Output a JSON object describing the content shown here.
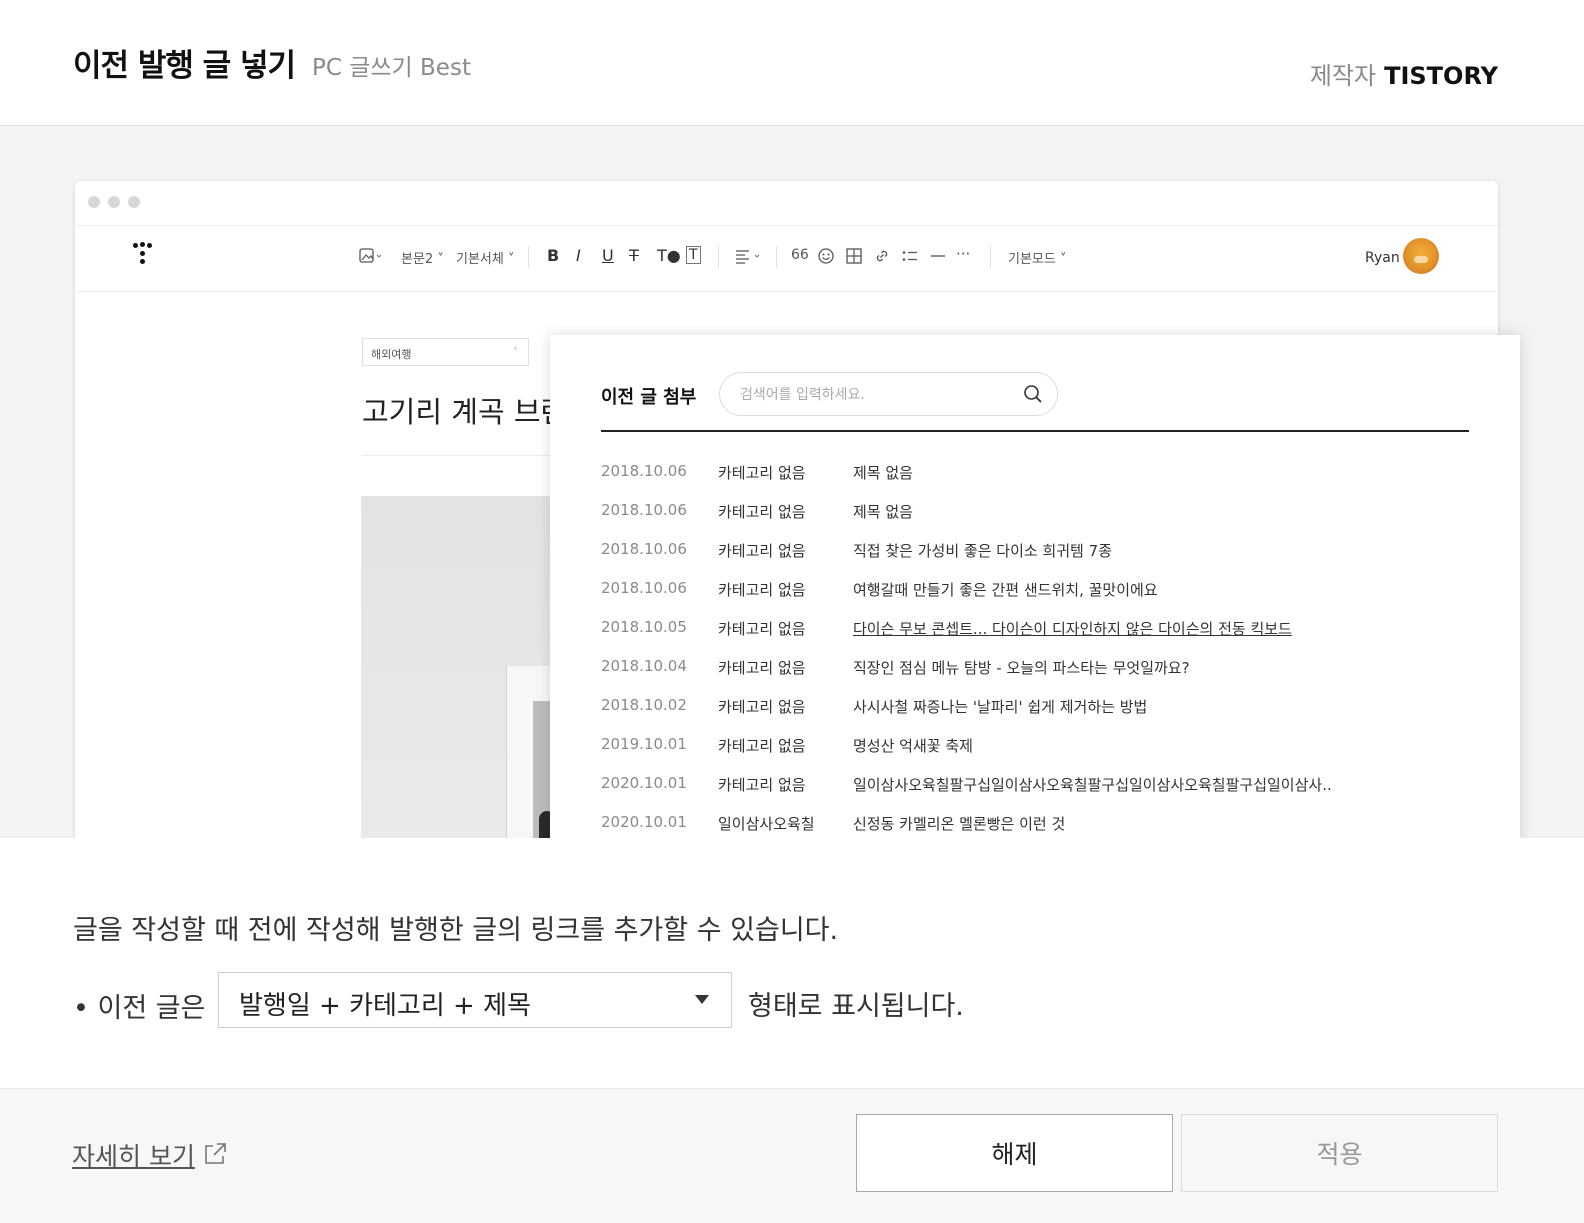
{
  "header": {
    "title": "이전 발행 글 넣기",
    "subtitle": "PC 글쓰기 Best",
    "maker_label": "제작자",
    "maker_name": "TISTORY"
  },
  "editor": {
    "toolbar": {
      "paragraph": "본문2",
      "font": "기본서체",
      "quote": "66",
      "more": "···",
      "mode": "기본모드"
    },
    "user": "Ryan",
    "category": "해외여행",
    "post_title": "고기리 계곡 브런"
  },
  "popup": {
    "title": "이전 글 첨부",
    "search_placeholder": "검색어를 입력하세요.",
    "posts": [
      {
        "date": "2018.10.06",
        "category": "카테고리 없음",
        "title": "제목 없음"
      },
      {
        "date": "2018.10.06",
        "category": "카테고리 없음",
        "title": "제목 없음"
      },
      {
        "date": "2018.10.06",
        "category": "카테고리 없음",
        "title": "직접 찾은 가성비 좋은 다이소 희귀템 7종"
      },
      {
        "date": "2018.10.06",
        "category": "카테고리 없음",
        "title": "여행갈때 만들기 좋은 간편 샌드위치, 꿀맛이에요"
      },
      {
        "date": "2018.10.05",
        "category": "카테고리 없음",
        "title": "다이슨 무보 콘셉트... 다이슨이 디자인하지 않은 다이슨의 전동 킥보드"
      },
      {
        "date": "2018.10.04",
        "category": "카테고리 없음",
        "title": "직장인 점심 메뉴 탐방 - 오늘의 파스타는 무엇일까요?"
      },
      {
        "date": "2018.10.02",
        "category": "카테고리 없음",
        "title": "사시사철 짜증나는 '날파리' 쉽게 제거하는 방법"
      },
      {
        "date": "2019.10.01",
        "category": "카테고리 없음",
        "title": "명성산 억새꽃 축제"
      },
      {
        "date": "2020.10.01",
        "category": "카테고리 없음",
        "title": "일이삼사오육칠팔구십일이삼사오육칠팔구십일이삼사오육칠팔구십일이삼사.."
      },
      {
        "date": "2020.10.01",
        "category": "일이삼사오육칠",
        "title": "신정동 카멜리온 멜론빵은 이런 것"
      }
    ]
  },
  "description": {
    "text": "글을 작성할 때 전에 작성해 발행한 글의 링크를 추가할 수 있습니다.",
    "prefix": "• 이전 글은",
    "format_value": "발행일 + 카테고리 + 제목",
    "suffix": "형태로 표시됩니다."
  },
  "footer": {
    "more_link": "자세히 보기",
    "release_button": "해제",
    "apply_button": "적용"
  }
}
